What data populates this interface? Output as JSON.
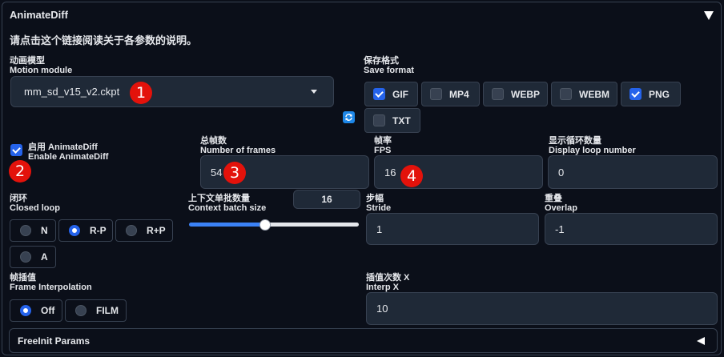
{
  "header": {
    "title": "AnimateDiff",
    "collapse_icon": "triangle-down-icon"
  },
  "description": {
    "prefix": "请点击",
    "link": "这个链接",
    "suffix": "阅读关于各参数的说明。"
  },
  "motion_module": {
    "label_zh": "动画模型",
    "label_en": "Motion module",
    "value": "mm_sd_v15_v2.ckpt",
    "refresh_icon": "refresh-icon"
  },
  "save_format": {
    "label_zh": "保存格式",
    "label_en": "Save format",
    "options": [
      {
        "label": "GIF",
        "checked": true
      },
      {
        "label": "MP4",
        "checked": false
      },
      {
        "label": "WEBP",
        "checked": false
      },
      {
        "label": "WEBM",
        "checked": false
      },
      {
        "label": "PNG",
        "checked": true
      },
      {
        "label": "TXT",
        "checked": false
      }
    ]
  },
  "enable": {
    "label_zh": "启用 AnimateDiff",
    "label_en": "Enable AnimateDiff",
    "checked": true
  },
  "frames": {
    "label_zh": "总帧数",
    "label_en": "Number of frames",
    "value": "54"
  },
  "fps": {
    "label_zh": "帧率",
    "label_en": "FPS",
    "value": "16"
  },
  "loop": {
    "label_zh": "显示循环数量",
    "label_en": "Display loop number",
    "value": "0"
  },
  "closed_loop": {
    "label_zh": "闭环",
    "label_en": "Closed loop",
    "options": [
      {
        "label": "N",
        "selected": false
      },
      {
        "label": "R-P",
        "selected": true
      },
      {
        "label": "R+P",
        "selected": false
      },
      {
        "label": "A",
        "selected": false
      }
    ]
  },
  "context_batch": {
    "label_zh": "上下文单批数量",
    "label_en": "Context batch size",
    "value": "16",
    "fraction": 0.45
  },
  "stride": {
    "label_zh": "步幅",
    "label_en": "Stride",
    "value": "1"
  },
  "overlap": {
    "label_zh": "重叠",
    "label_en": "Overlap",
    "value": "-1"
  },
  "interp": {
    "label_zh": "帧插值",
    "label_en": "Frame Interpolation",
    "options": [
      {
        "label": "Off",
        "selected": true
      },
      {
        "label": "FILM",
        "selected": false
      }
    ]
  },
  "interp_x": {
    "label_zh": "插值次数 X",
    "label_en": "Interp X",
    "value": "10"
  },
  "freeinit": {
    "label": "FreeInit Params",
    "expand_icon": "triangle-left-icon"
  },
  "annotations": [
    "1",
    "2",
    "3",
    "4"
  ]
}
